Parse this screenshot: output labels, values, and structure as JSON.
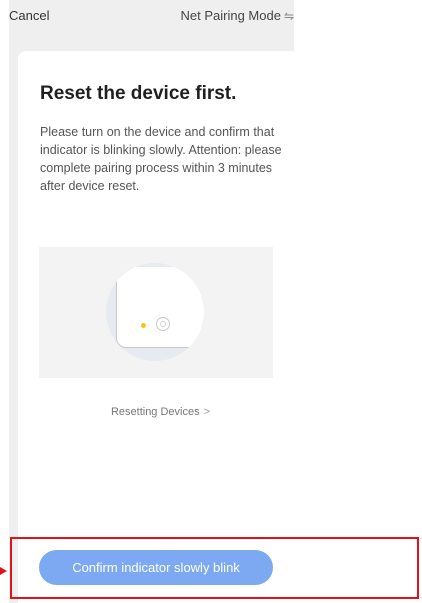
{
  "topbar": {
    "cancel_label": "Cancel",
    "mode_label": "Net Pairing Mode",
    "mode_icon": "⇋"
  },
  "card": {
    "title": "Reset the device first.",
    "description": "Please turn on the device and confirm that indicator is blinking slowly. Attention: please complete pairing process within 3 minutes after device reset.",
    "link_label": "Resetting Devices",
    "link_chevron": ">"
  },
  "confirm_button": {
    "label": "Confirm indicator slowly blink"
  },
  "colors": {
    "button_bg": "#7da9f3",
    "led": "#f5c518",
    "highlight": "#e0131b",
    "screen_bg": "#efefef"
  }
}
